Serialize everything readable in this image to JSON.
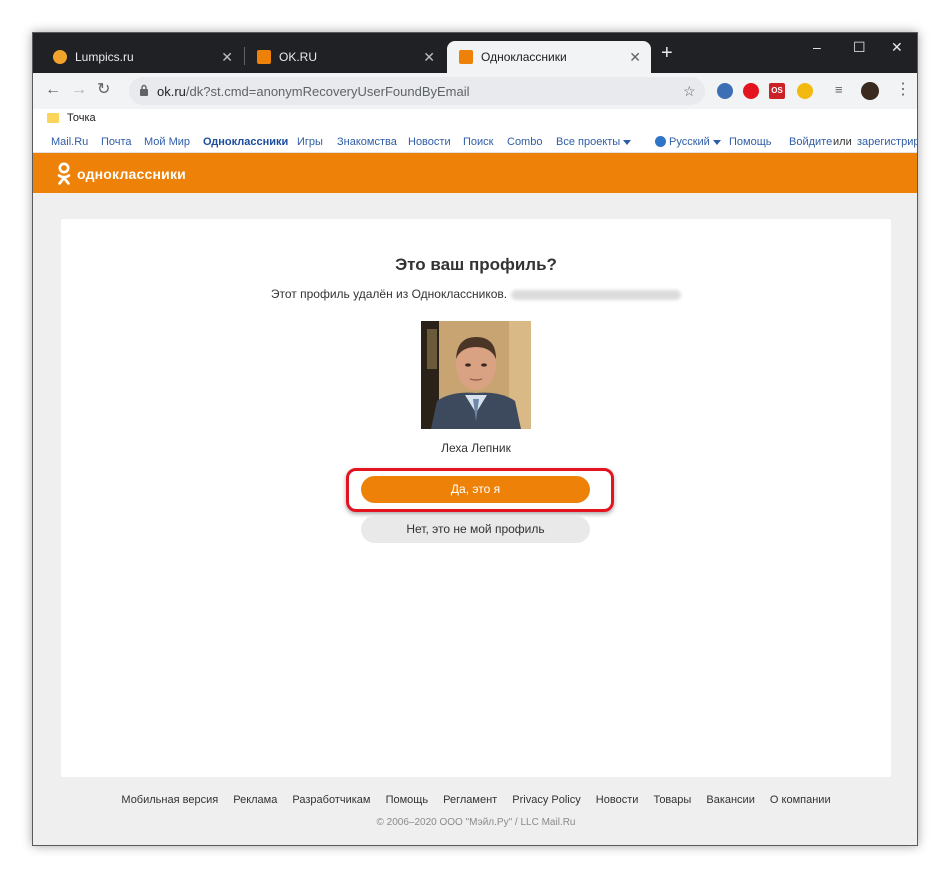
{
  "browser": {
    "tabs": [
      {
        "title": "Lumpics.ru",
        "favicon_color": "#f2a32c"
      },
      {
        "title": "OK.RU",
        "favicon_color": "#ee8208"
      },
      {
        "title": "Одноклассники",
        "favicon_color": "#ee8208",
        "active": true
      }
    ],
    "new_tab": "+",
    "window_controls": {
      "minimize": "–",
      "maximize": "☐",
      "close": "✕"
    },
    "url_host": "ok.ru",
    "url_path": "/dk?st.cmd=anonymRecoveryUserFoundByEmail",
    "bookmark": "Точка",
    "extensions": [
      {
        "name": "vpn-extension-icon",
        "color": "#3d6fb5",
        "text": ""
      },
      {
        "name": "opera-extension-icon",
        "color": "#e3141f",
        "text": ""
      },
      {
        "name": "lastpass-extension-icon",
        "color": "#cc2127",
        "text": "OS"
      },
      {
        "name": "shield-extension-icon",
        "color": "#f2b90f",
        "text": ""
      }
    ]
  },
  "portal_bar": {
    "links": [
      "Mail.Ru",
      "Почта",
      "Мой Мир",
      "Одноклассники",
      "Игры",
      "Знакомства",
      "Новости",
      "Поиск",
      "Combo",
      "Все проекты"
    ],
    "language": "Русский",
    "help": "Помощь",
    "login": "Войдите",
    "or": "или",
    "register": "зарегистриру"
  },
  "ok_header": {
    "brand": "одноклассники",
    "brand_color": "#ee8208"
  },
  "profile_card": {
    "title": "Это ваш профиль?",
    "subtitle": "Этот профиль удалён из Одноклассников.",
    "name": "Леха Лепник",
    "confirm_button": "Да, это я",
    "deny_button": "Нет, это не мой профиль"
  },
  "footer": {
    "links": [
      "Мобильная версия",
      "Реклама",
      "Разработчикам",
      "Помощь",
      "Регламент",
      "Privacy Policy",
      "Новости",
      "Товары",
      "Вакансии",
      "О компании"
    ],
    "copyright": "© 2006–2020 ООО \"Мэйл.Ру\" / LLC Mail.Ru"
  }
}
